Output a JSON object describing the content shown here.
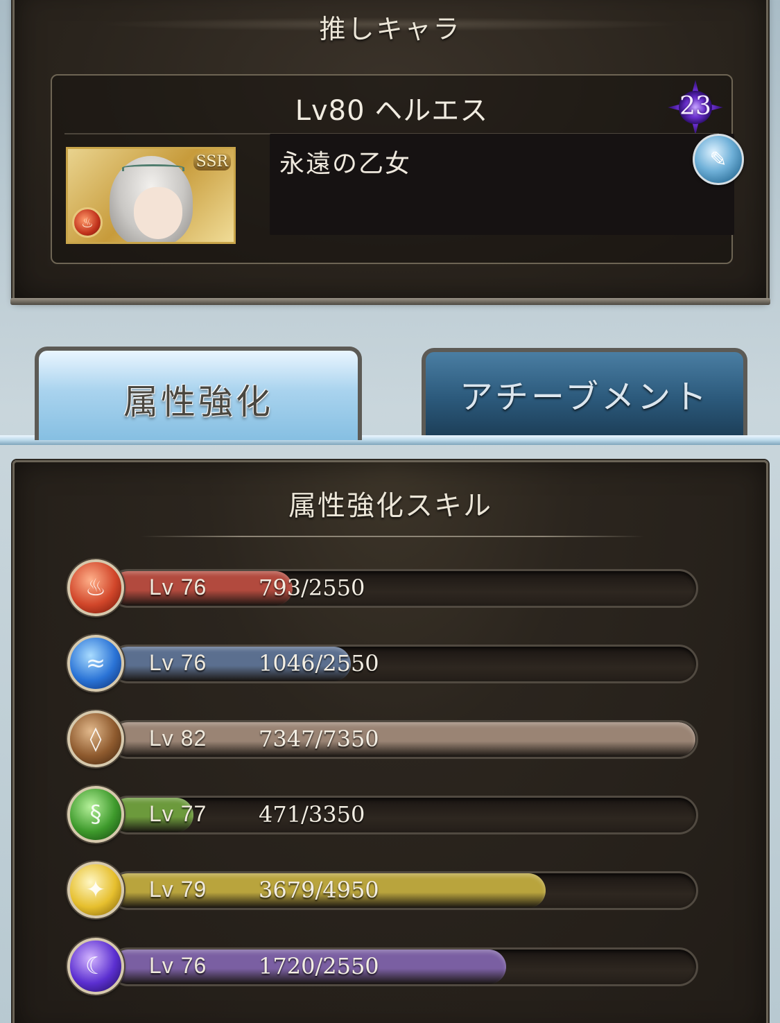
{
  "favorite": {
    "title": "推しキャラ",
    "name": "Lv80 ヘルエス",
    "rank": "23",
    "rarity": "SSR",
    "motto": "永遠の乙女"
  },
  "tabs": [
    {
      "label": "属性強化",
      "active": true
    },
    {
      "label": "アチーブメント",
      "active": false
    }
  ],
  "skills": {
    "title": "属性強化スキル",
    "items": [
      {
        "element": "fire",
        "icon": "fire-element-icon",
        "level": "Lv 76",
        "exp": "793/2550",
        "progress": 0.311,
        "color": "#b24a3e"
      },
      {
        "element": "water",
        "icon": "water-element-icon",
        "level": "Lv 76",
        "exp": "1046/2550",
        "progress": 0.41,
        "color": "#5b6f8f"
      },
      {
        "element": "earth",
        "icon": "earth-element-icon",
        "level": "Lv 82",
        "exp": "7347/7350",
        "progress": 0.999,
        "color": "#9a8474"
      },
      {
        "element": "wind",
        "icon": "wind-element-icon",
        "level": "Lv 77",
        "exp": "471/3350",
        "progress": 0.141,
        "color": "#6c9a3c"
      },
      {
        "element": "light",
        "icon": "light-element-icon",
        "level": "Lv 79",
        "exp": "3679/4950",
        "progress": 0.743,
        "color": "#b9a43d"
      },
      {
        "element": "dark",
        "icon": "dark-element-icon",
        "level": "Lv 76",
        "exp": "1720/2550",
        "progress": 0.675,
        "color": "#7a5fa2"
      }
    ]
  }
}
